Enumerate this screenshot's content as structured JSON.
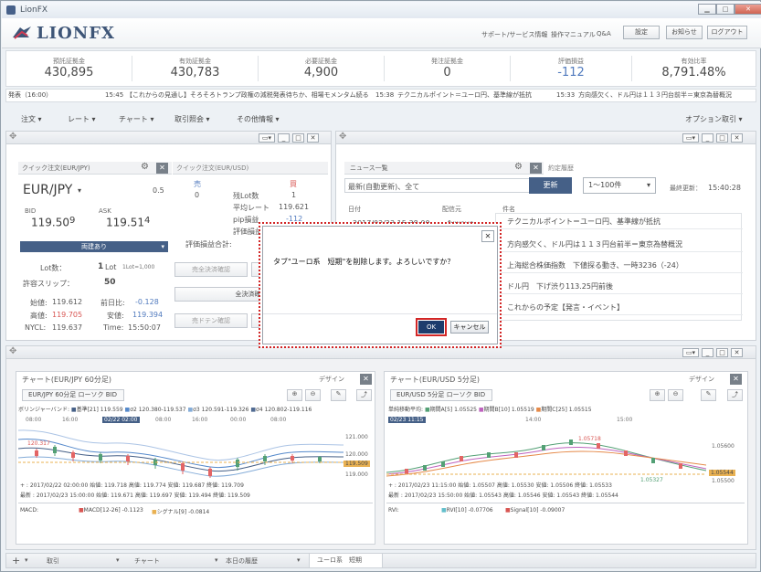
{
  "window": {
    "title": "LionFX"
  },
  "header": {
    "logo": "LIONFX",
    "links": [
      "サポート/サービス情報",
      "操作マニュアル",
      "Q&A"
    ],
    "buttons": [
      "設定",
      "お知らせ",
      "ログアウト"
    ]
  },
  "summary": [
    {
      "label": "預託証拠金",
      "value": "430,895"
    },
    {
      "label": "有効証拠金",
      "value": "430,783"
    },
    {
      "label": "必要証拠金",
      "value": "4,900"
    },
    {
      "label": "発注証拠金",
      "value": "0"
    },
    {
      "label": "評価損益",
      "value": "-112"
    },
    {
      "label": "有効比率",
      "value": "8,791.48%"
    }
  ],
  "ticker": {
    "prefix": "発表（16:00）",
    "items": [
      {
        "time": "15:45",
        "text": "【これからの見通し】そろそろトランプ政権の減税発表待ちか、相場モメンタム続る"
      },
      {
        "time": "15:38",
        "text": "テクニカルポイント＝ユーロ円、基準線が抵抗"
      },
      {
        "time": "15:33",
        "text": "方向感欠く、ドル円は１１３円台前半＝東京為替概況"
      }
    ]
  },
  "menu": {
    "items": [
      "注文",
      "レート",
      "チャート",
      "取引照会",
      "その他情報"
    ],
    "right": "オプション取引"
  },
  "quick_order": {
    "tab": "クイック注文(EUR/JPY)",
    "tab2": "クイック注文(EUR/USD)",
    "pair": "EUR/JPY",
    "spread": "0.5",
    "bid_label": "BID",
    "ask_label": "ASK",
    "bid_main": "119.50",
    "bid_pip": "9",
    "ask_main": "119.51",
    "ask_pip": "4",
    "mode": "両建あり",
    "lot_label": "Lot数：",
    "lot_value": "1",
    "lot_unit": "Lot",
    "lot_note": "1Lot=1,000",
    "slip_label": "許容スリップ：",
    "slip_value": "50",
    "open_label": "始値:",
    "open": "119.612",
    "high_label": "高値:",
    "high": "119.705",
    "nycl_label": "NYCL:",
    "nycl": "119.637",
    "chg_label": "前日比:",
    "chg": "-0.128",
    "low_label": "安値:",
    "low": "119.394",
    "time_label": "Time:",
    "time": "15:50:07",
    "sell": "売",
    "buy": "買",
    "sell_lots": "0",
    "buy_lots": "1",
    "rows": [
      [
        "残Lot数",
        ""
      ],
      [
        "平均レート",
        "119.621"
      ],
      [
        "pip損益",
        "-112"
      ],
      [
        "評価損益",
        ""
      ]
    ],
    "eval_total": "評価損益合計:",
    "buttons": [
      "売全決済確認",
      "全決済確認",
      "売ドテン確認"
    ]
  },
  "news": {
    "tab": "ニュース一覧",
    "tab2": "約定履歴",
    "filter": "最新(自動更新)、全て",
    "update": "更新",
    "range": "1〜100件",
    "last_update_label": "最終更新：",
    "last_update": "15:40:28",
    "cols": [
      "日付",
      "配信元",
      "件名"
    ],
    "first_date": "2017/02/23 15:38:00",
    "first_src": "fxwave",
    "rows": [
      "テクニカルポイント＝ユーロ円、基準線が抵抗",
      "方向感欠く、ドル円は１１３円台前半＝東京為替概況",
      "上海総合株価指数　下値探る動き、一時3236（-24）",
      "ドル円　下げ渋り113.25円前後",
      "これからの予定【発言・イベント】"
    ]
  },
  "dialog": {
    "message": "タブ\"ユーロ系　短期\"を削除します。よろしいですか？",
    "ok": "OK",
    "cancel": "キャンセル"
  },
  "chart1": {
    "title": "チャート(EUR/JPY 60分足)",
    "design": "デザイン",
    "selector": "EUR/JPY 60分足 ローソク BID",
    "legend": [
      "ボリンジャーバンド:",
      "基準[21] 119.559",
      "σ2 120.380-119.537",
      "σ3 120.591-119.326",
      "σ4 120.802-119.116"
    ],
    "times": [
      "08:00",
      "16:00",
      "02/22 02:00",
      "08:00",
      "16:00",
      "00:00",
      "08:00"
    ],
    "price_labels": [
      "121.000",
      "120.000",
      "119.509",
      "119.000"
    ],
    "marker": "120.317",
    "cur": "119.509",
    "info1": "+ : 2017/02/22 02:00:00 始値: 119.718 高値: 119.774 安値: 119.687 終値: 119.709",
    "info2": "最新 : 2017/02/23 15:00:00 始値: 119.671 高値: 119.697 安値: 119.494 終値: 119.509",
    "sub": "MACD:",
    "sub_leg": [
      "MACD[12-26] -0.1123",
      "シグナル[9] -0.0814"
    ]
  },
  "chart2": {
    "title": "チャート(EUR/USD 5分足)",
    "design": "デザイン",
    "selector": "EUR/USD 5分足 ローソク BID",
    "legend": [
      "単純移動平均:",
      "期間A[5] 1.05525",
      "期間B[10] 1.05519",
      "期間C[25] 1.05515"
    ],
    "times": [
      "02/23 11:15",
      "14:00",
      "15:00"
    ],
    "price_labels": [
      "1.05600",
      "1.05544",
      "1.05500"
    ],
    "marker": "1.05718",
    "cur": "1.05544",
    "low_mark": "1.05327",
    "info1": "+ : 2017/02/23 11:15:00 始値: 1.05507 高値: 1.05530 安値: 1.05506 終値: 1.05533",
    "info2": "最新 : 2017/02/23 15:50:00 始値: 1.05543 高値: 1.05546 安値: 1.05543 終値: 1.05544",
    "sub": "RVI:",
    "sub_leg": [
      "RVI[10] -0.07706",
      "Signal[10] -0.09007"
    ]
  },
  "tabs": {
    "plus": "+",
    "items": [
      "取引",
      "チャート",
      "本日の履歴",
      "ユーロ系　短期"
    ]
  },
  "colors": {
    "navy": "#14305a",
    "sell": "#2a5db0",
    "buy": "#d0302c",
    "up": "#2e8b57",
    "down": "#d44"
  }
}
